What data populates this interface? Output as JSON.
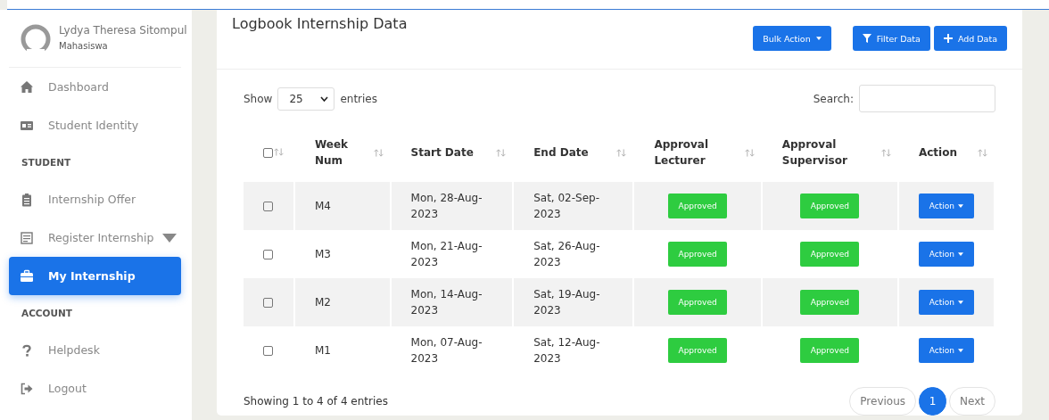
{
  "user": {
    "name": "Lydya Theresa Sitompul",
    "role": "Mahasiswa"
  },
  "sidebar": {
    "items": [
      {
        "kind": "link",
        "label": "Dashboard",
        "selected": false
      },
      {
        "kind": "link",
        "label": "Student Identity",
        "selected": false
      },
      {
        "kind": "section",
        "label": "STUDENT"
      },
      {
        "kind": "link",
        "label": "Internship Offer",
        "selected": false
      },
      {
        "kind": "link",
        "label": "Register Internship",
        "selected": false,
        "has_caret": true
      },
      {
        "kind": "link",
        "label": "My Internship",
        "selected": true
      },
      {
        "kind": "section",
        "label": "ACCOUNT"
      },
      {
        "kind": "link",
        "label": "Helpdesk",
        "selected": false
      },
      {
        "kind": "link",
        "label": "Logout",
        "selected": false
      }
    ]
  },
  "card": {
    "title": "Logbook Internship Data",
    "buttons": [
      {
        "kind": "dropdown",
        "label": "Bulk Action"
      },
      {
        "kind": "filter",
        "label": "Filter Data"
      },
      {
        "kind": "add",
        "label": "Add Data"
      }
    ],
    "length": {
      "before": "Show",
      "value": "25",
      "after": "entries"
    },
    "search": {
      "label": "Search:"
    },
    "table": {
      "select_all": {
        "checked": false
      },
      "columns": [
        "Week Num",
        "Start Date",
        "End Date",
        "Approval Lecturer",
        "Approval Supervisor",
        "Action"
      ],
      "rows": [
        {
          "checked": false,
          "week": "M4",
          "start": "Mon, 28-Aug-2023",
          "end": "Sat, 02-Sep-2023",
          "lecturer": "Approved",
          "supervisor": "Approved",
          "action": "Action"
        },
        {
          "checked": false,
          "week": "M3",
          "start": "Mon, 21-Aug-2023",
          "end": "Sat, 26-Aug-2023",
          "lecturer": "Approved",
          "supervisor": "Approved",
          "action": "Action"
        },
        {
          "checked": false,
          "week": "M2",
          "start": "Mon, 14-Aug-2023",
          "end": "Sat, 19-Aug-2023",
          "lecturer": "Approved",
          "supervisor": "Approved",
          "action": "Action"
        },
        {
          "checked": false,
          "week": "M1",
          "start": "Mon, 07-Aug-2023",
          "end": "Sat, 12-Aug-2023",
          "lecturer": "Approved",
          "supervisor": "Approved",
          "action": "Action"
        }
      ]
    },
    "info": "Showing 1 to 4 of 4 entries",
    "pagination": {
      "previous": "Previous",
      "pages": [
        {
          "label": "1",
          "selected": true
        }
      ],
      "next": "Next"
    }
  }
}
